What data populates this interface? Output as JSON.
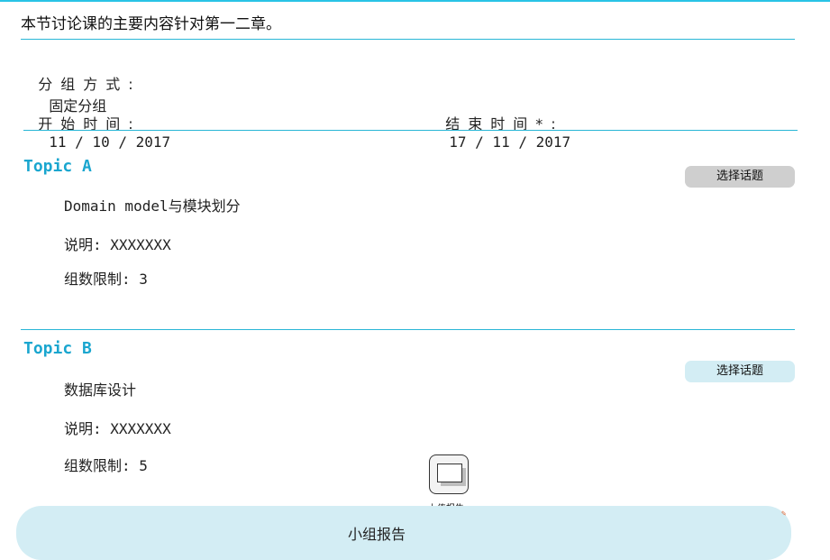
{
  "intro": "本节讨论课的主要内容针对第一二章。",
  "grouping": {
    "label": "分组方式:",
    "value": "固定分组"
  },
  "start": {
    "label": "开始时间:",
    "value": "11 / 10 / 2017"
  },
  "end": {
    "label": "结束时间*:",
    "value": "17 / 11 / 2017"
  },
  "topics": [
    {
      "title": "Topic A",
      "name": "Domain model与模块划分",
      "description": "说明: XXXXXXX",
      "limit": "组数限制: 3",
      "button": "选择话题",
      "button_state": "disabled"
    },
    {
      "title": "Topic B",
      "name": "数据库设计",
      "description": "说明: XXXXXXX",
      "limit": "组数限制: 5",
      "button": "选择话题",
      "button_state": "enabled"
    }
  ],
  "upload": {
    "label": "上传报告",
    "icon": "upload-screen-icon"
  },
  "bottom_panel": {
    "title": "小组报告"
  },
  "colors": {
    "accent": "#1aa6cf",
    "divider": "#29b6d6",
    "button_grey": "#cfcfcf",
    "button_blue": "#d3edf4"
  }
}
